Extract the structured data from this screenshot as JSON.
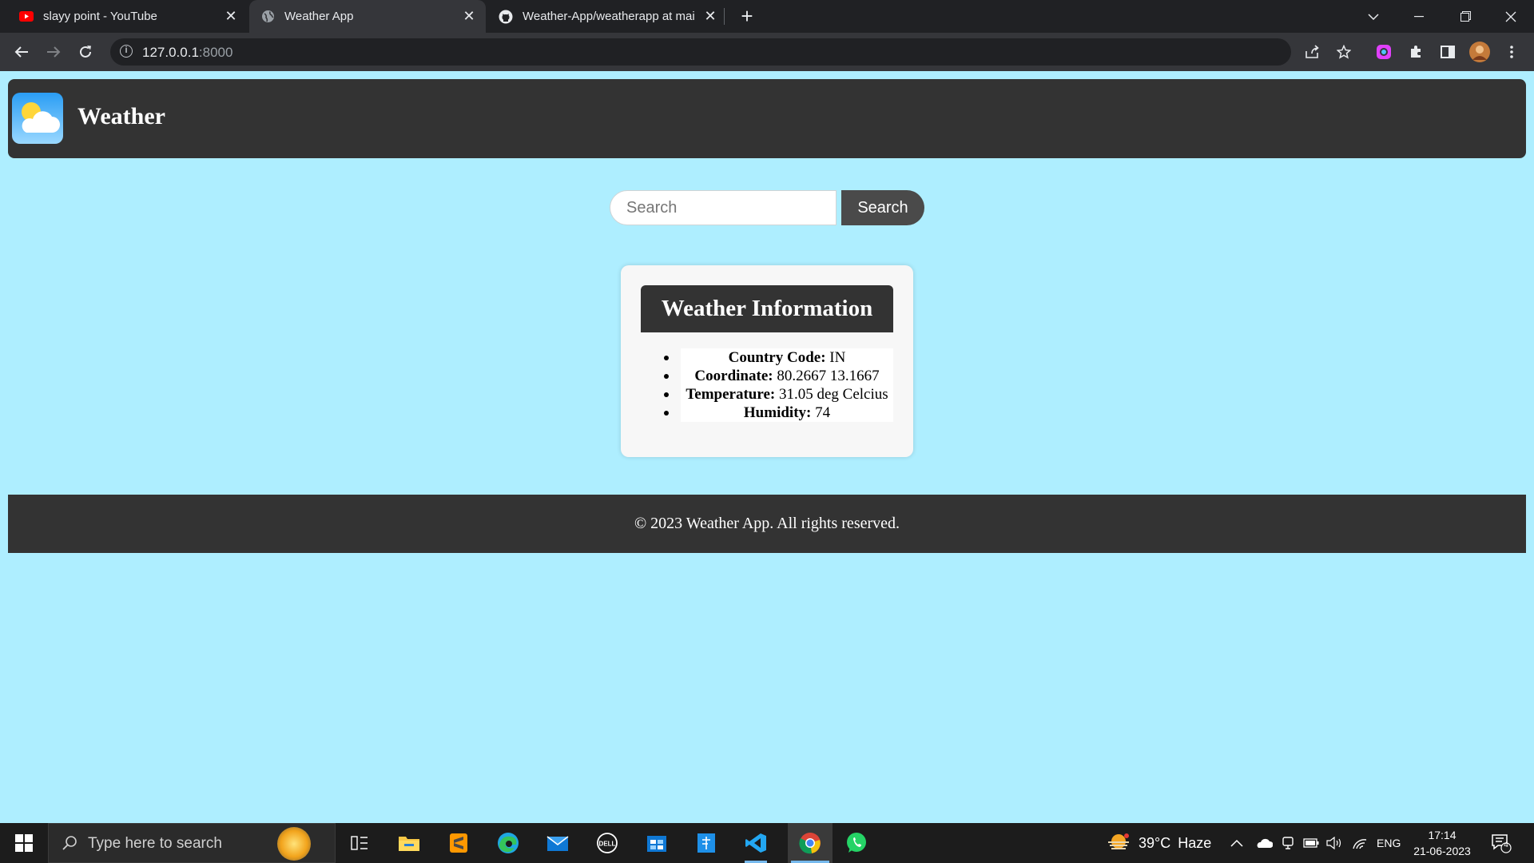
{
  "browser": {
    "tabs": [
      {
        "title": "slayy point - YouTube",
        "icon": "youtube-icon",
        "active": false
      },
      {
        "title": "Weather App",
        "icon": "globe-icon",
        "active": true
      },
      {
        "title": "Weather-App/weatherapp at mai",
        "icon": "github-icon",
        "active": false
      }
    ],
    "address": {
      "host": "127.0.0.1",
      "port": ":8000"
    }
  },
  "site": {
    "brand": "Weather"
  },
  "search": {
    "placeholder": "Search",
    "value": "",
    "button_label": "Search"
  },
  "weather_card": {
    "title": "Weather Information",
    "items": [
      {
        "label": "Country Code:",
        "value": "IN"
      },
      {
        "label": "Coordinate:",
        "value": "80.2667 13.1667"
      },
      {
        "label": "Temperature:",
        "value": "31.05 deg Celcius"
      },
      {
        "label": "Humidity:",
        "value": "74"
      }
    ]
  },
  "footer": {
    "text": "© 2023 Weather App. All rights reserved."
  },
  "taskbar": {
    "search_placeholder": "Type here to search",
    "weather": {
      "temp": "39°C",
      "condition": "Haze"
    },
    "language": "ENG",
    "time": "17:14",
    "date": "21-06-2023",
    "notification_count": "4"
  },
  "colors": {
    "page_background": "#aeeeff",
    "header_background": "#333333",
    "card_background": "#f7f7f7",
    "button_background": "#4a4a4a"
  }
}
